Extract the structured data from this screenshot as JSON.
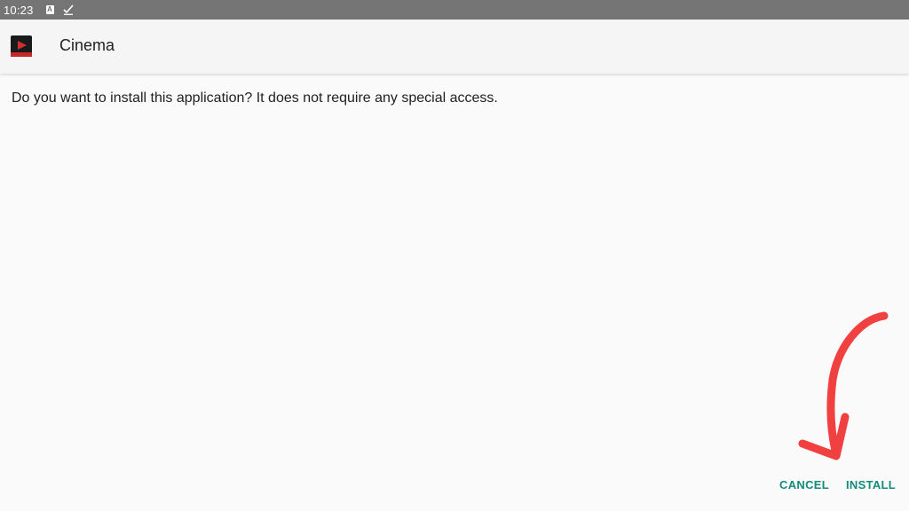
{
  "status_bar": {
    "time": "10:23",
    "icons": [
      "a-icon",
      "check-icon"
    ],
    "a_icon_glyph": "A"
  },
  "app_bar": {
    "title": "Cinema",
    "icon": "cinema-app-icon"
  },
  "message": "Do you want to install this application? It does not require any special access.",
  "actions": {
    "cancel_label": "CANCEL",
    "install_label": "INSTALL"
  },
  "colors": {
    "status_bar": "#757575",
    "background": "#fafafa",
    "accent": "#138a7b",
    "annotation_arrow": "#f04040"
  }
}
